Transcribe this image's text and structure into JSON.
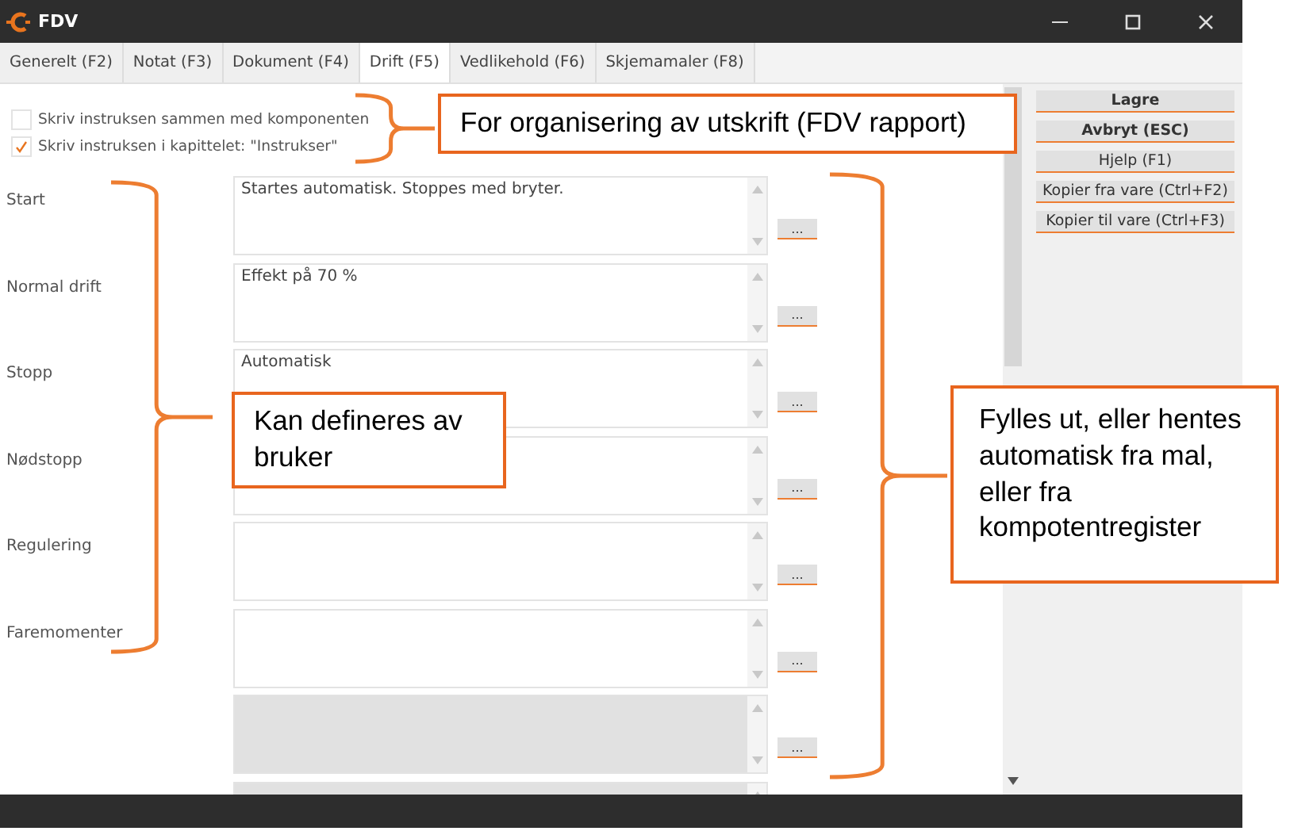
{
  "window": {
    "title": "FDV"
  },
  "tabs": [
    {
      "label": "Generelt (F2)",
      "selected": false
    },
    {
      "label": "Notat (F3)",
      "selected": false
    },
    {
      "label": "Dokument (F4)",
      "selected": false
    },
    {
      "label": "Drift (F5)",
      "selected": true
    },
    {
      "label": "Vedlikehold (F6)",
      "selected": false
    },
    {
      "label": "Skjemamaler (F8)",
      "selected": false
    }
  ],
  "options": [
    {
      "label": "Skriv instruksen sammen med komponenten",
      "checked": false
    },
    {
      "label": "Skriv instruksen i kapittelet: \"Instrukser\"",
      "checked": true
    }
  ],
  "fields": [
    {
      "label": "Start",
      "value": "Startes automatisk. Stoppes med bryter.",
      "disabled": false,
      "button": "..."
    },
    {
      "label": "Normal drift",
      "value": "Effekt på 70 %",
      "disabled": false,
      "button": "..."
    },
    {
      "label": "Stopp",
      "value": "Automatisk",
      "disabled": false,
      "button": "..."
    },
    {
      "label": "Nødstopp",
      "disabled": false,
      "button": "..."
    },
    {
      "label": "Regulering",
      "disabled": false,
      "button": "..."
    },
    {
      "label": "Faremomenter",
      "disabled": false,
      "button": "..."
    },
    {
      "disabled": true,
      "button": "..."
    },
    {
      "disabled": true
    }
  ],
  "actions": [
    {
      "label": "Lagre",
      "kind": "primary"
    },
    {
      "label": "Avbryt (ESC)",
      "kind": "primary"
    },
    {
      "label": "Hjelp (F1)",
      "kind": "normal"
    },
    {
      "label": "Kopier fra vare (Ctrl+F2)",
      "kind": "normal"
    },
    {
      "label": "Kopier til vare (Ctrl+F3)",
      "kind": "normal"
    }
  ],
  "callouts": [
    "For organisering av utskrift (FDV rapport)",
    "Kan defineres av bruker",
    "Fylles ut, eller hentes automatisk fra mal, eller fra kompotentregister"
  ]
}
